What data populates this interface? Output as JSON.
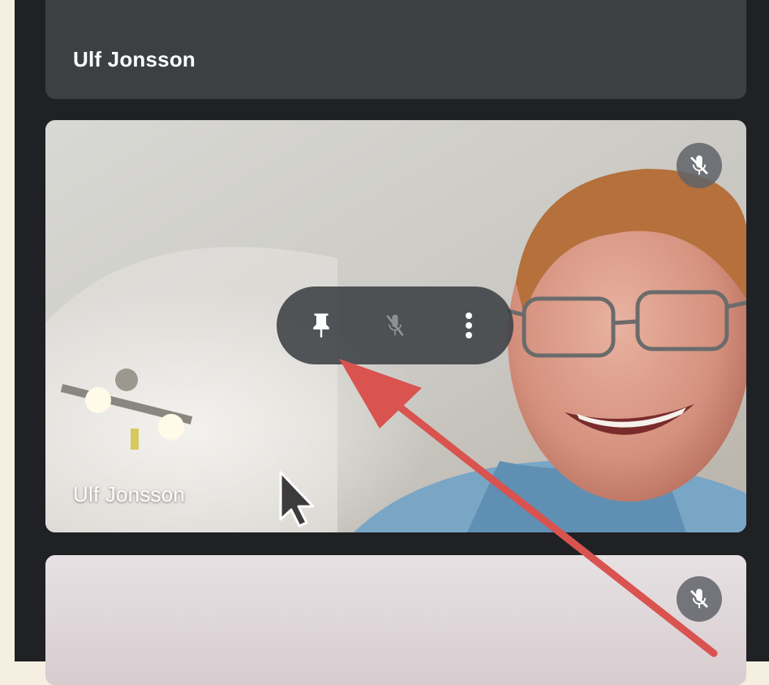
{
  "participants": [
    {
      "name": "Ulf Jonsson",
      "muted": true
    },
    {
      "name": "Ulf Jonsson",
      "muted": true,
      "hover_controls": [
        "pin-icon",
        "mic-off-icon",
        "more-vert-icon"
      ]
    },
    {
      "name": "",
      "muted": true
    }
  ],
  "colors": {
    "panel_bg": "#202124",
    "tile_bg": "#3c4043",
    "annotation_arrow": "#d9534f"
  }
}
